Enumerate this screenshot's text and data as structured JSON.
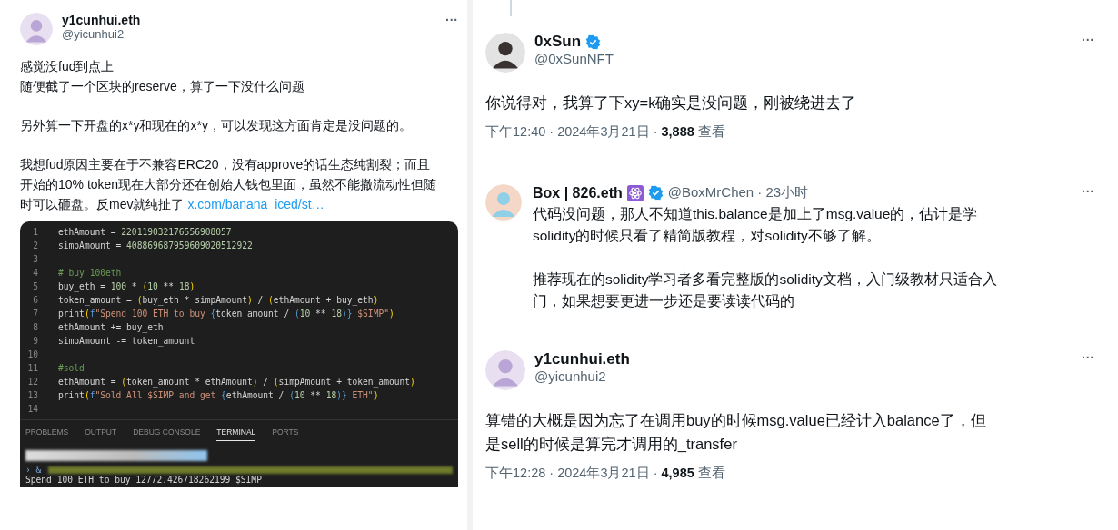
{
  "left_tweet": {
    "author": {
      "name": "y1cunhui.eth",
      "handle": "@yicunhui2"
    },
    "more": "···",
    "paragraphs": [
      [
        "感觉没fud到点上",
        "随便截了一个区块的reserve，算了一下没什么问题"
      ],
      [
        "另外算一下开盘的x*y和现在的x*y，可以发现这方面肯定是没问题的。"
      ],
      [
        "我想fud原因主要在于不兼容ERC20，没有approve的话生态纯割裂；而且",
        "开始的10% token现在大部分还在创始人钱包里面，虽然不能撤流动性但随",
        "时可以砸盘。反mev就纯扯了"
      ]
    ],
    "link": "x.com/banana_iced/st…",
    "editor": {
      "lines": [
        {
          "number": "1",
          "tokens": [
            {
              "kind": "plain",
              "text": "ethAmount = "
            },
            {
              "kind": "number",
              "text": "220119032176556908057"
            }
          ]
        },
        {
          "number": "2",
          "tokens": [
            {
              "kind": "plain",
              "text": "simpAmount = "
            },
            {
              "kind": "number",
              "text": "408869687959609020512922"
            }
          ]
        },
        {
          "number": "3"
        },
        {
          "number": "4",
          "tokens": [
            {
              "kind": "comment",
              "text": "# buy 100eth"
            }
          ]
        },
        {
          "number": "5",
          "tokens": [
            {
              "kind": "plain",
              "text": "buy_eth = "
            },
            {
              "kind": "number",
              "text": "100"
            },
            {
              "kind": "plain",
              "text": " * "
            },
            {
              "kind": "paren",
              "text": "("
            },
            {
              "kind": "number",
              "text": "10"
            },
            {
              "kind": "plain",
              "text": " ** "
            },
            {
              "kind": "number",
              "text": "18"
            },
            {
              "kind": "paren",
              "text": ")"
            }
          ]
        },
        {
          "number": "6",
          "tokens": [
            {
              "kind": "plain",
              "text": "token_amount = "
            },
            {
              "kind": "paren",
              "text": "("
            },
            {
              "kind": "plain",
              "text": "buy_eth * simpAmount"
            },
            {
              "kind": "paren",
              "text": ")"
            },
            {
              "kind": "plain",
              "text": " / "
            },
            {
              "kind": "paren",
              "text": "("
            },
            {
              "kind": "plain",
              "text": "ethAmount + buy_eth"
            },
            {
              "kind": "paren",
              "text": ")"
            }
          ]
        },
        {
          "number": "7",
          "tokens": [
            {
              "kind": "plain",
              "text": "print"
            },
            {
              "kind": "paren",
              "text": "("
            },
            {
              "kind": "keyword",
              "text": "f"
            },
            {
              "kind": "string",
              "text": "\"Spend 100 ETH to buy "
            },
            {
              "kind": "brace",
              "text": "{"
            },
            {
              "kind": "plain",
              "text": "token_amount / "
            },
            {
              "kind": "brace",
              "text": "("
            },
            {
              "kind": "number",
              "text": "10"
            },
            {
              "kind": "plain",
              "text": " ** "
            },
            {
              "kind": "number",
              "text": "18"
            },
            {
              "kind": "brace",
              "text": ")}"
            },
            {
              "kind": "string",
              "text": " $SIMP\""
            },
            {
              "kind": "paren",
              "text": ")"
            }
          ]
        },
        {
          "number": "8",
          "tokens": [
            {
              "kind": "plain",
              "text": "ethAmount += buy_eth"
            }
          ]
        },
        {
          "number": "9",
          "tokens": [
            {
              "kind": "plain",
              "text": "simpAmount -= token_amount"
            }
          ]
        },
        {
          "number": "10"
        },
        {
          "number": "11",
          "tokens": [
            {
              "kind": "comment",
              "text": "#sold"
            }
          ]
        },
        {
          "number": "12",
          "tokens": [
            {
              "kind": "plain",
              "text": "ethAmount = "
            },
            {
              "kind": "paren",
              "text": "("
            },
            {
              "kind": "plain",
              "text": "token_amount * ethAmount"
            },
            {
              "kind": "paren",
              "text": ")"
            },
            {
              "kind": "plain",
              "text": " / "
            },
            {
              "kind": "paren",
              "text": "("
            },
            {
              "kind": "plain",
              "text": "simpAmount + token_amount"
            },
            {
              "kind": "paren",
              "text": ")"
            }
          ]
        },
        {
          "number": "13",
          "tokens": [
            {
              "kind": "plain",
              "text": "print"
            },
            {
              "kind": "paren",
              "text": "("
            },
            {
              "kind": "keyword",
              "text": "f"
            },
            {
              "kind": "string",
              "text": "\"Sold All $SIMP and get "
            },
            {
              "kind": "brace",
              "text": "{"
            },
            {
              "kind": "plain",
              "text": "ethAmount / "
            },
            {
              "kind": "brace",
              "text": "("
            },
            {
              "kind": "number",
              "text": "10"
            },
            {
              "kind": "plain",
              "text": " ** "
            },
            {
              "kind": "number",
              "text": "18"
            },
            {
              "kind": "brace",
              "text": ")}"
            },
            {
              "kind": "string",
              "text": " ETH\""
            },
            {
              "kind": "paren",
              "text": ")"
            }
          ]
        },
        {
          "number": "14"
        }
      ],
      "panel_tabs": [
        {
          "label": "PROBLEMS",
          "selected": false
        },
        {
          "label": "OUTPUT",
          "selected": false
        },
        {
          "label": "DEBUG CONSOLE",
          "selected": false
        },
        {
          "label": "TERMINAL",
          "selected": true
        },
        {
          "label": "PORTS",
          "selected": false
        }
      ],
      "terminal": {
        "prompt": "› &",
        "output": "Spend 100 ETH to buy 12772.426718262199 $SIMP"
      }
    }
  },
  "right_thread": [
    {
      "kind": "main",
      "author": {
        "name": "0xSun",
        "handle": "@0xSunNFT",
        "verified": true,
        "badge": false
      },
      "more": "···",
      "paragraphs": [
        [
          "你说得对，我算了下xy=k确实是没问题，刚被绕进去了"
        ]
      ],
      "meta": "下午12:40 · 2024年3月21日 · **3,888** 查看"
    },
    {
      "kind": "reply",
      "author": {
        "name": "Box | 826.eth",
        "handle": "@BoxMrChen · 23小时",
        "verified": true,
        "badge": true
      },
      "more": "···",
      "paragraphs": [
        [
          "代码没问题，那人不知道this.balance是加上了msg.value的，估计是学",
          "solidity的时候只看了精简版教程，对solidity不够了解。"
        ],
        [
          "推荐现在的solidity学习者多看完整版的solidity文档，入门级教材只适合入",
          "门，如果想要更进一步还是要读读代码的"
        ]
      ]
    },
    {
      "kind": "main",
      "author": {
        "name": "y1cunhui.eth",
        "handle": "@yicunhui2",
        "verified": false,
        "badge": false
      },
      "more": "···",
      "paragraphs": [
        [
          "算错的大概是因为忘了在调用buy的时候msg.value已经计入balance了，但",
          "是sell的时候是算完才调用的_transfer"
        ]
      ],
      "meta": "下午12:28 · 2024年3月21日 · **4,985** 查看"
    }
  ]
}
